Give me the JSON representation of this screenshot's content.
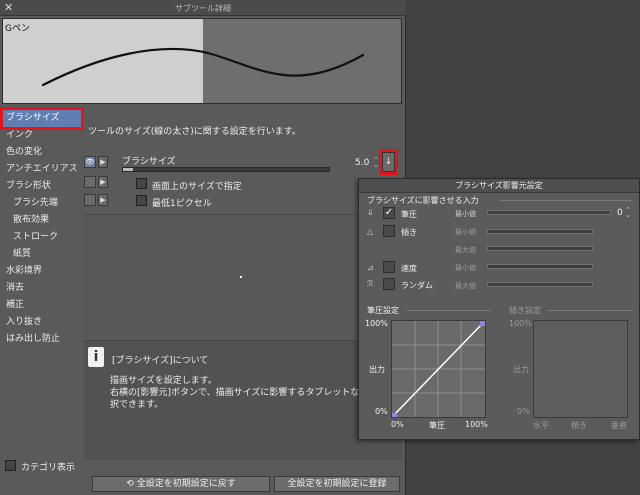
{
  "window": {
    "title": "サブツール詳細",
    "close_icon": "close-icon"
  },
  "preview": {
    "brush_name": "Gペン"
  },
  "categories": [
    {
      "label": "ブラシサイズ",
      "selected": true
    },
    {
      "label": "インク"
    },
    {
      "label": "色の変化"
    },
    {
      "label": "アンチエイリアス"
    },
    {
      "label": "ブラシ形状"
    },
    {
      "label": "ブラシ先端",
      "sub": true
    },
    {
      "label": "散布効果",
      "sub": true
    },
    {
      "label": "ストローク",
      "sub": true
    },
    {
      "label": "紙質",
      "sub": true
    },
    {
      "label": "水彩境界"
    },
    {
      "label": "消去"
    },
    {
      "label": "補正"
    },
    {
      "label": "入り抜き"
    },
    {
      "label": "はみ出し防止"
    }
  ],
  "panel": {
    "description": "ツールのサイズ(線の太さ)に関する設定を行います。",
    "brush_size_label": "ブラシサイズ",
    "brush_size_value": "5.0",
    "brush_size_fraction": 0.05,
    "option1": "画面上のサイズで指定",
    "option2": "最低1ピクセル"
  },
  "info": {
    "title": "[ブラシサイズ]について",
    "line1": "描画サイズを設定します。",
    "line2": "右横の[影響元]ボタンで、描画サイズに影響するタブレットなどの",
    "line3": "択できます。"
  },
  "bottom": {
    "category_display": "カテゴリ表示",
    "reset_all": "全設定を初期設定に戻す",
    "register_all": "全設定を初期設定に登録"
  },
  "popup": {
    "title": "ブラシサイズ影響元設定",
    "section_input": "ブラシサイズに影響させる入力",
    "inputs": [
      {
        "label": "筆圧",
        "checked": true,
        "min_label": "最小値",
        "min_value": "0"
      },
      {
        "label": "傾き",
        "checked": false,
        "min_label": "最小値"
      },
      {
        "label": "",
        "checked": false,
        "min_label": "最大値"
      },
      {
        "label": "速度",
        "checked": false,
        "min_label": "最小値"
      },
      {
        "label": "",
        "checked": false,
        "min_label": "最大値"
      },
      {
        "label": "ランダム",
        "checked": false,
        "min_label": "最小値"
      }
    ],
    "pressure_settings": "筆圧設定",
    "tilt_settings": "傾き設定",
    "pressure_graph": {
      "y_top": "100%",
      "y_mid": "出力",
      "y_bottom": "0%",
      "x_left": "0%",
      "x_mid": "筆圧",
      "x_right": "100%"
    },
    "tilt_graph": {
      "y_top": "100%",
      "y_mid": "出力",
      "y_bottom": "0%",
      "x_left": "水平",
      "x_mid": "傾き",
      "x_right": "垂直"
    }
  },
  "colors": {
    "selection": "#5f7fb3",
    "highlight": "#e5141b",
    "curve_handle": "#8f84e8"
  }
}
